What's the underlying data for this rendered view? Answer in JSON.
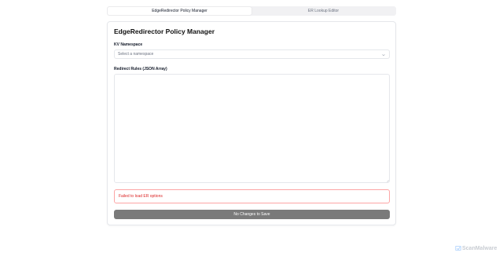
{
  "tabs": [
    {
      "label": "EdgeRedirector Policy Manager",
      "active": true
    },
    {
      "label": "ER Lookup Editor",
      "active": false
    }
  ],
  "card": {
    "title": "EdgeRedirector Policy Manager",
    "namespace_label": "KV Namespace",
    "namespace_placeholder": "Select a namespace",
    "rules_label": "Redirect Rules (JSON Array)",
    "rules_value": "",
    "error_message": "Failed to load ER options",
    "save_label": "No Changes to Save"
  },
  "watermark": {
    "text": "ScanMalware"
  },
  "icons": {
    "select": "chevron-down-icon",
    "watermark": "scanmalware-logo-icon"
  }
}
